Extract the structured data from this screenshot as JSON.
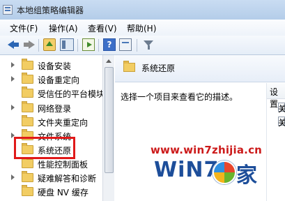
{
  "window": {
    "title": "本地组策略编辑器"
  },
  "menu": [
    {
      "label": "文件(F)"
    },
    {
      "label": "操作(A)"
    },
    {
      "label": "查看(V)"
    },
    {
      "label": "帮助(H)"
    }
  ],
  "toolbar": {
    "icons": [
      "back-icon",
      "forward-icon",
      "up-icon",
      "show-tree-icon",
      "export-icon",
      "help-icon",
      "view-icon",
      "filter-icon"
    ]
  },
  "tree": {
    "items": [
      {
        "label": "设备安装",
        "expandable": true
      },
      {
        "label": "设备重定向",
        "expandable": true
      },
      {
        "label": "受信任的平台模块",
        "expandable": false
      },
      {
        "label": "网络登录",
        "expandable": true
      },
      {
        "label": "文件夹重定向",
        "expandable": false
      },
      {
        "label": "文件系统",
        "expandable": true
      },
      {
        "label": "系统还原",
        "expandable": false,
        "selected": true
      },
      {
        "label": "性能控制面板",
        "expandable": false
      },
      {
        "label": "疑难解答和诊断",
        "expandable": true
      },
      {
        "label": "硬盘 NV 缓存",
        "expandable": false
      }
    ]
  },
  "details": {
    "header": "系统还原",
    "description": "选择一个项目来查看它的描述。",
    "column_header": "设置",
    "rows": [
      {
        "label": "关"
      },
      {
        "label": "关"
      }
    ]
  },
  "watermark": {
    "url": "www.win7zhijia.cn",
    "logo_left": "WiN7",
    "logo_right": "家"
  },
  "colors": {
    "highlight": "#e01919",
    "accent": "#2b66b4"
  }
}
